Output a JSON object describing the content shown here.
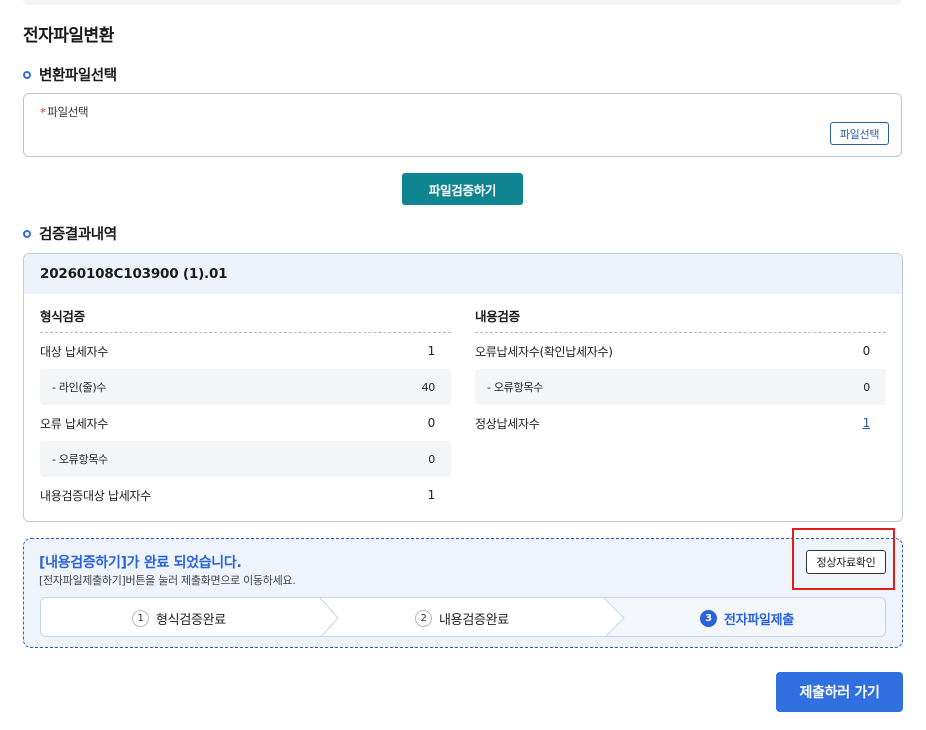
{
  "page": {
    "title": "전자파일변환"
  },
  "section_select": {
    "title": "변환파일선택"
  },
  "file_select": {
    "required_mark": "*",
    "label": "파일선택",
    "button_label": "파일선택"
  },
  "verify_button": {
    "label": "파일검증하기"
  },
  "section_result": {
    "title": "검증결과내역"
  },
  "result": {
    "file_name": "20260108C103900 (1).01",
    "format_check": {
      "title": "형식검증",
      "rows": [
        {
          "label": "대상 납세자수",
          "value": "1",
          "sub": false
        },
        {
          "label": "- 라인(줄)수",
          "value": "40",
          "sub": true
        },
        {
          "label": "오류 납세자수",
          "value": "0",
          "sub": false
        },
        {
          "label": "- 오류항목수",
          "value": "0",
          "sub": true
        },
        {
          "label": "내용검증대상 납세자수",
          "value": "1",
          "sub": false
        }
      ]
    },
    "content_check": {
      "title": "내용검증",
      "rows": [
        {
          "label": "오류납세자수(확인납세자수)",
          "value": "0",
          "sub": false
        },
        {
          "label": "- 오류항목수",
          "value": "0",
          "sub": true
        },
        {
          "label": "정상납세자수",
          "value": "1",
          "sub": false,
          "link": true
        }
      ]
    }
  },
  "status": {
    "title": "[내용검증하기]가 완료 되었습니다.",
    "desc": "[전자파일제출하기]버튼을 눌러 제출화면으로 이동하세요.",
    "normal_button": "정상자료확인",
    "steps": [
      {
        "num": "1",
        "label": "형식검증완료",
        "active": false
      },
      {
        "num": "2",
        "label": "내용검증완료",
        "active": false
      },
      {
        "num": "3",
        "label": "전자파일제출",
        "active": true
      }
    ]
  },
  "submit_button": {
    "label": "제출하러 가기"
  },
  "colors": {
    "accent": "#2f6fe0",
    "teal": "#0f8591",
    "highlight": "#e01e1e"
  }
}
